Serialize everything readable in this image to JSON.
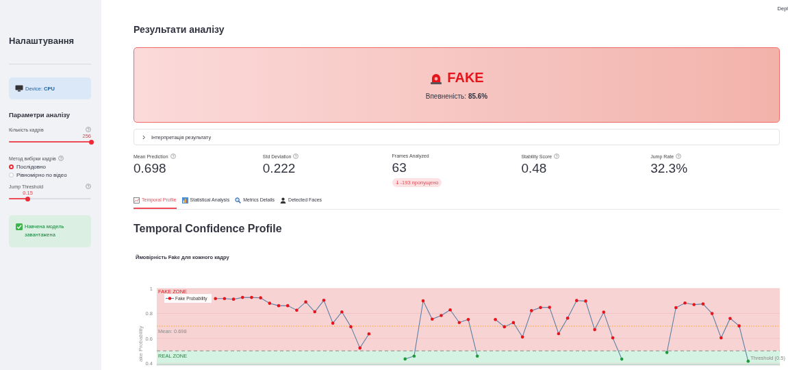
{
  "header": {
    "deploy": "Depl"
  },
  "sidebar": {
    "title": "Налаштування",
    "device": "Device: **CPU**",
    "section": "Параметри аналізу",
    "frames_slider": {
      "label": "Кількість кадрів",
      "value": "256",
      "level": 1
    },
    "method": {
      "label": "Метод вибірки кадрів",
      "options": [
        {
          "label": "Послідовно",
          "selected": true
        },
        {
          "label": "Рівномірно по відео",
          "selected": false
        }
      ]
    },
    "jump_slider": {
      "label": "Jump Threshold",
      "value": "0.15",
      "level": 0.23
    },
    "status": "Навчена модель завантажена"
  },
  "main": {
    "title": "Результати аналізу",
    "verdict": {
      "label": "FAKE",
      "confidence": "Впевненість: **85.6%**"
    },
    "expander": {
      "label": "Інтерпретація результату",
      "expanded": false
    },
    "metrics": [
      {
        "label": "Mean Prediction",
        "help": true,
        "value": "0.698"
      },
      {
        "label": "Std Deviation",
        "help": true,
        "value": "0.222"
      },
      {
        "label": "Frames Analyzed",
        "help": false,
        "value": "63",
        "delta": "-193 пропущено"
      },
      {
        "label": "Stability Score",
        "help": true,
        "value": "0.48"
      },
      {
        "label": "Jump Rate",
        "help": true,
        "value": "32.3%"
      }
    ],
    "tabs": [
      {
        "label": "Temporal Profile",
        "kind": "line",
        "selected": true
      },
      {
        "label": "Statistical Analysis",
        "kind": "bars",
        "selected": false
      },
      {
        "label": "Metrics Details",
        "kind": "search",
        "selected": false
      },
      {
        "label": "Detected Faces",
        "kind": "person",
        "selected": false
      }
    ],
    "section_title": "Temporal Confidence Profile",
    "chart_title": "Ймовірність Fake для кожного кадру",
    "chart_data": {
      "type": "line",
      "ylabel": "ake Probability",
      "grid": true,
      "ylim": [
        0.385,
        1.0
      ],
      "yticks": [
        {
          "value": 0.4,
          "label": "0.4"
        },
        {
          "value": 0.6,
          "label": "0.6"
        },
        {
          "value": 0.8,
          "label": "0.8"
        },
        {
          "value": 1,
          "label": "1"
        }
      ],
      "categories": [
        null,
        null,
        null,
        null,
        null,
        null,
        null,
        null,
        null,
        null,
        null,
        null,
        null,
        null,
        null,
        null,
        null,
        null,
        null,
        null,
        null,
        null,
        null,
        null,
        null,
        null,
        null,
        null,
        null,
        null,
        null,
        null,
        null,
        null,
        null,
        null,
        null,
        null,
        null,
        null,
        null,
        null,
        null,
        null,
        null,
        null,
        null,
        null,
        null,
        null,
        null,
        null,
        null,
        null,
        null,
        null,
        null,
        null,
        null,
        null,
        null,
        null,
        null,
        null,
        null,
        null,
        null,
        null,
        null
      ],
      "series": [
        {
          "name": "Fake Probability",
          "color": "#5b7fa6",
          "values": [
            null,
            null,
            null,
            null,
            null,
            null,
            0.919,
            0.919,
            0.914,
            0.928,
            0.928,
            0.925,
            0.881,
            0.862,
            0.862,
            0.826,
            0.892,
            0.813,
            0.905,
            0.722,
            0.812,
            0.693,
            0.523,
            0.636,
            null,
            null,
            null,
            0.435,
            0.458,
            0.901,
            0.754,
            0.783,
            0.828,
            0.727,
            0.751,
            0.458,
            null,
            0.751,
            0.693,
            0.726,
            0.611,
            0.822,
            0.847,
            0.849,
            0.638,
            0.762,
            0.903,
            0.899,
            0.67,
            0.81,
            0.604,
            0.434,
            null,
            null,
            null,
            null,
            0.487,
            0.846,
            0.883,
            0.871,
            0.876,
            0.799,
            0.604,
            0.76,
            0.7,
            0.417,
            null,
            null,
            null
          ]
        }
      ],
      "ref_lines": [
        {
          "axis": "y",
          "value": 0.698,
          "label": "Mean: 0.698"
        },
        {
          "axis": "y",
          "value": 0.5,
          "label": "Threshold (0.5)"
        }
      ],
      "bands": [
        {
          "axis": "y",
          "from": 0.5,
          "to": 1,
          "label": "FAKE ZONE"
        },
        {
          "axis": "y",
          "from": 0,
          "to": 0.5,
          "label": "REAL ZONE"
        }
      ]
    }
  }
}
